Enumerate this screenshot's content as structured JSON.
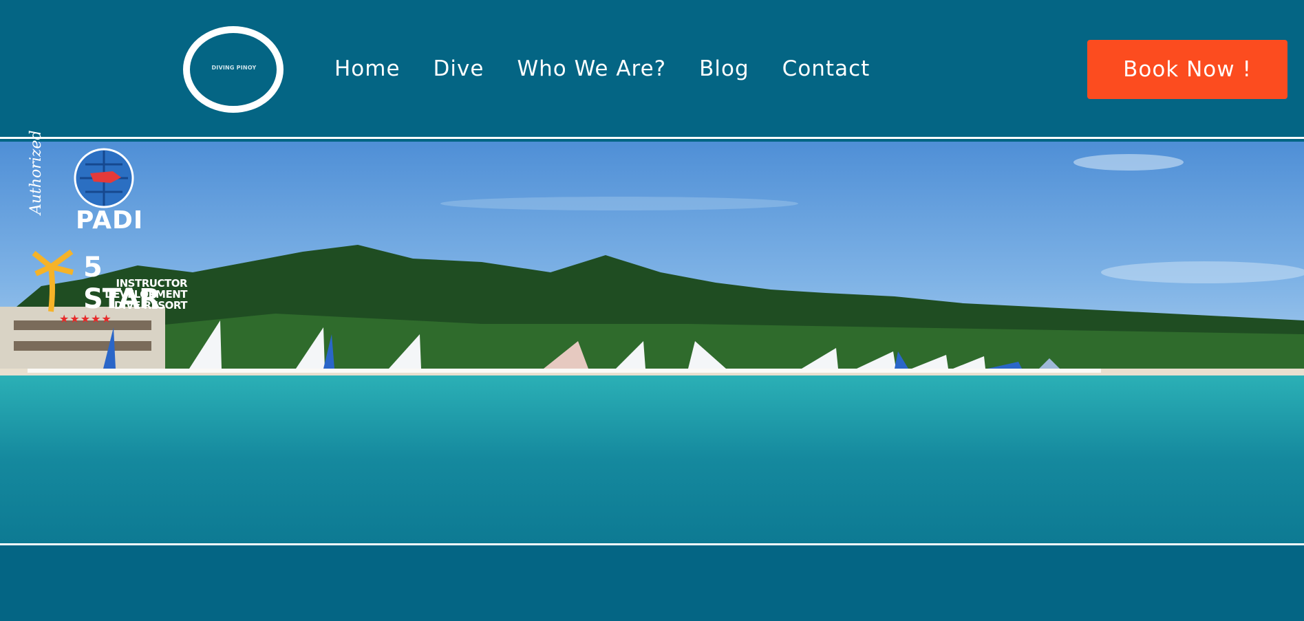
{
  "header": {
    "logo_text": "DIVING PINOY",
    "nav": [
      "Home",
      "Dive",
      "Who We Are?",
      "Blog",
      "Contact"
    ],
    "book_label": "Book Now !"
  },
  "badge": {
    "authorized": "Authorized",
    "brand": "PADI",
    "rating": "5 STAR",
    "line1": "INSTRUCTOR",
    "line2": "DEVELOPMENT",
    "line3": "DIVE RESORT",
    "stars": "★★★★★"
  },
  "colors": {
    "background": "#046584",
    "accent": "#fc4c1f",
    "text": "#ffffff"
  }
}
